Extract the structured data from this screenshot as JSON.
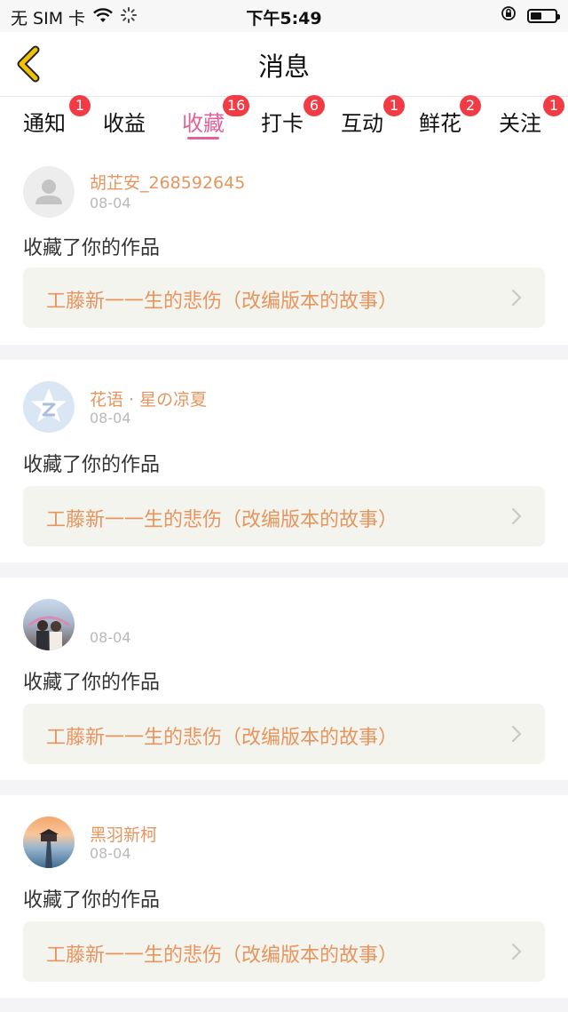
{
  "status_bar": {
    "carrier": "无 SIM 卡",
    "time": "下午5:49"
  },
  "nav": {
    "title": "消息"
  },
  "tabs": [
    {
      "label": "通知",
      "badge": "1"
    },
    {
      "label": "收益",
      "badge": ""
    },
    {
      "label": "收藏",
      "badge": "16",
      "active": true
    },
    {
      "label": "打卡",
      "badge": "6"
    },
    {
      "label": "互动",
      "badge": "1"
    },
    {
      "label": "鲜花",
      "badge": "2"
    },
    {
      "label": "关注",
      "badge": "1"
    }
  ],
  "messages": [
    {
      "user": "胡芷安_268592645",
      "date": "08-04",
      "action": "收藏了你的作品",
      "work": "工藤新一一生的悲伤（改编版本的故事）"
    },
    {
      "user": "花语 · 星の凉夏",
      "date": "08-04",
      "action": "收藏了你的作品",
      "work": "工藤新一一生的悲伤（改编版本的故事）"
    },
    {
      "user": "",
      "date": "08-04",
      "action": "收藏了你的作品",
      "work": "工藤新一一生的悲伤（改编版本的故事）"
    },
    {
      "user": "黑羽新柯",
      "date": "08-04",
      "action": "收藏了你的作品",
      "work": "工藤新一一生的悲伤（改编版本的故事）"
    }
  ],
  "colors": {
    "accent": "#e3619a",
    "name": "#e6955e",
    "badge": "#f13b45",
    "back_arrow": "#f2c200"
  }
}
